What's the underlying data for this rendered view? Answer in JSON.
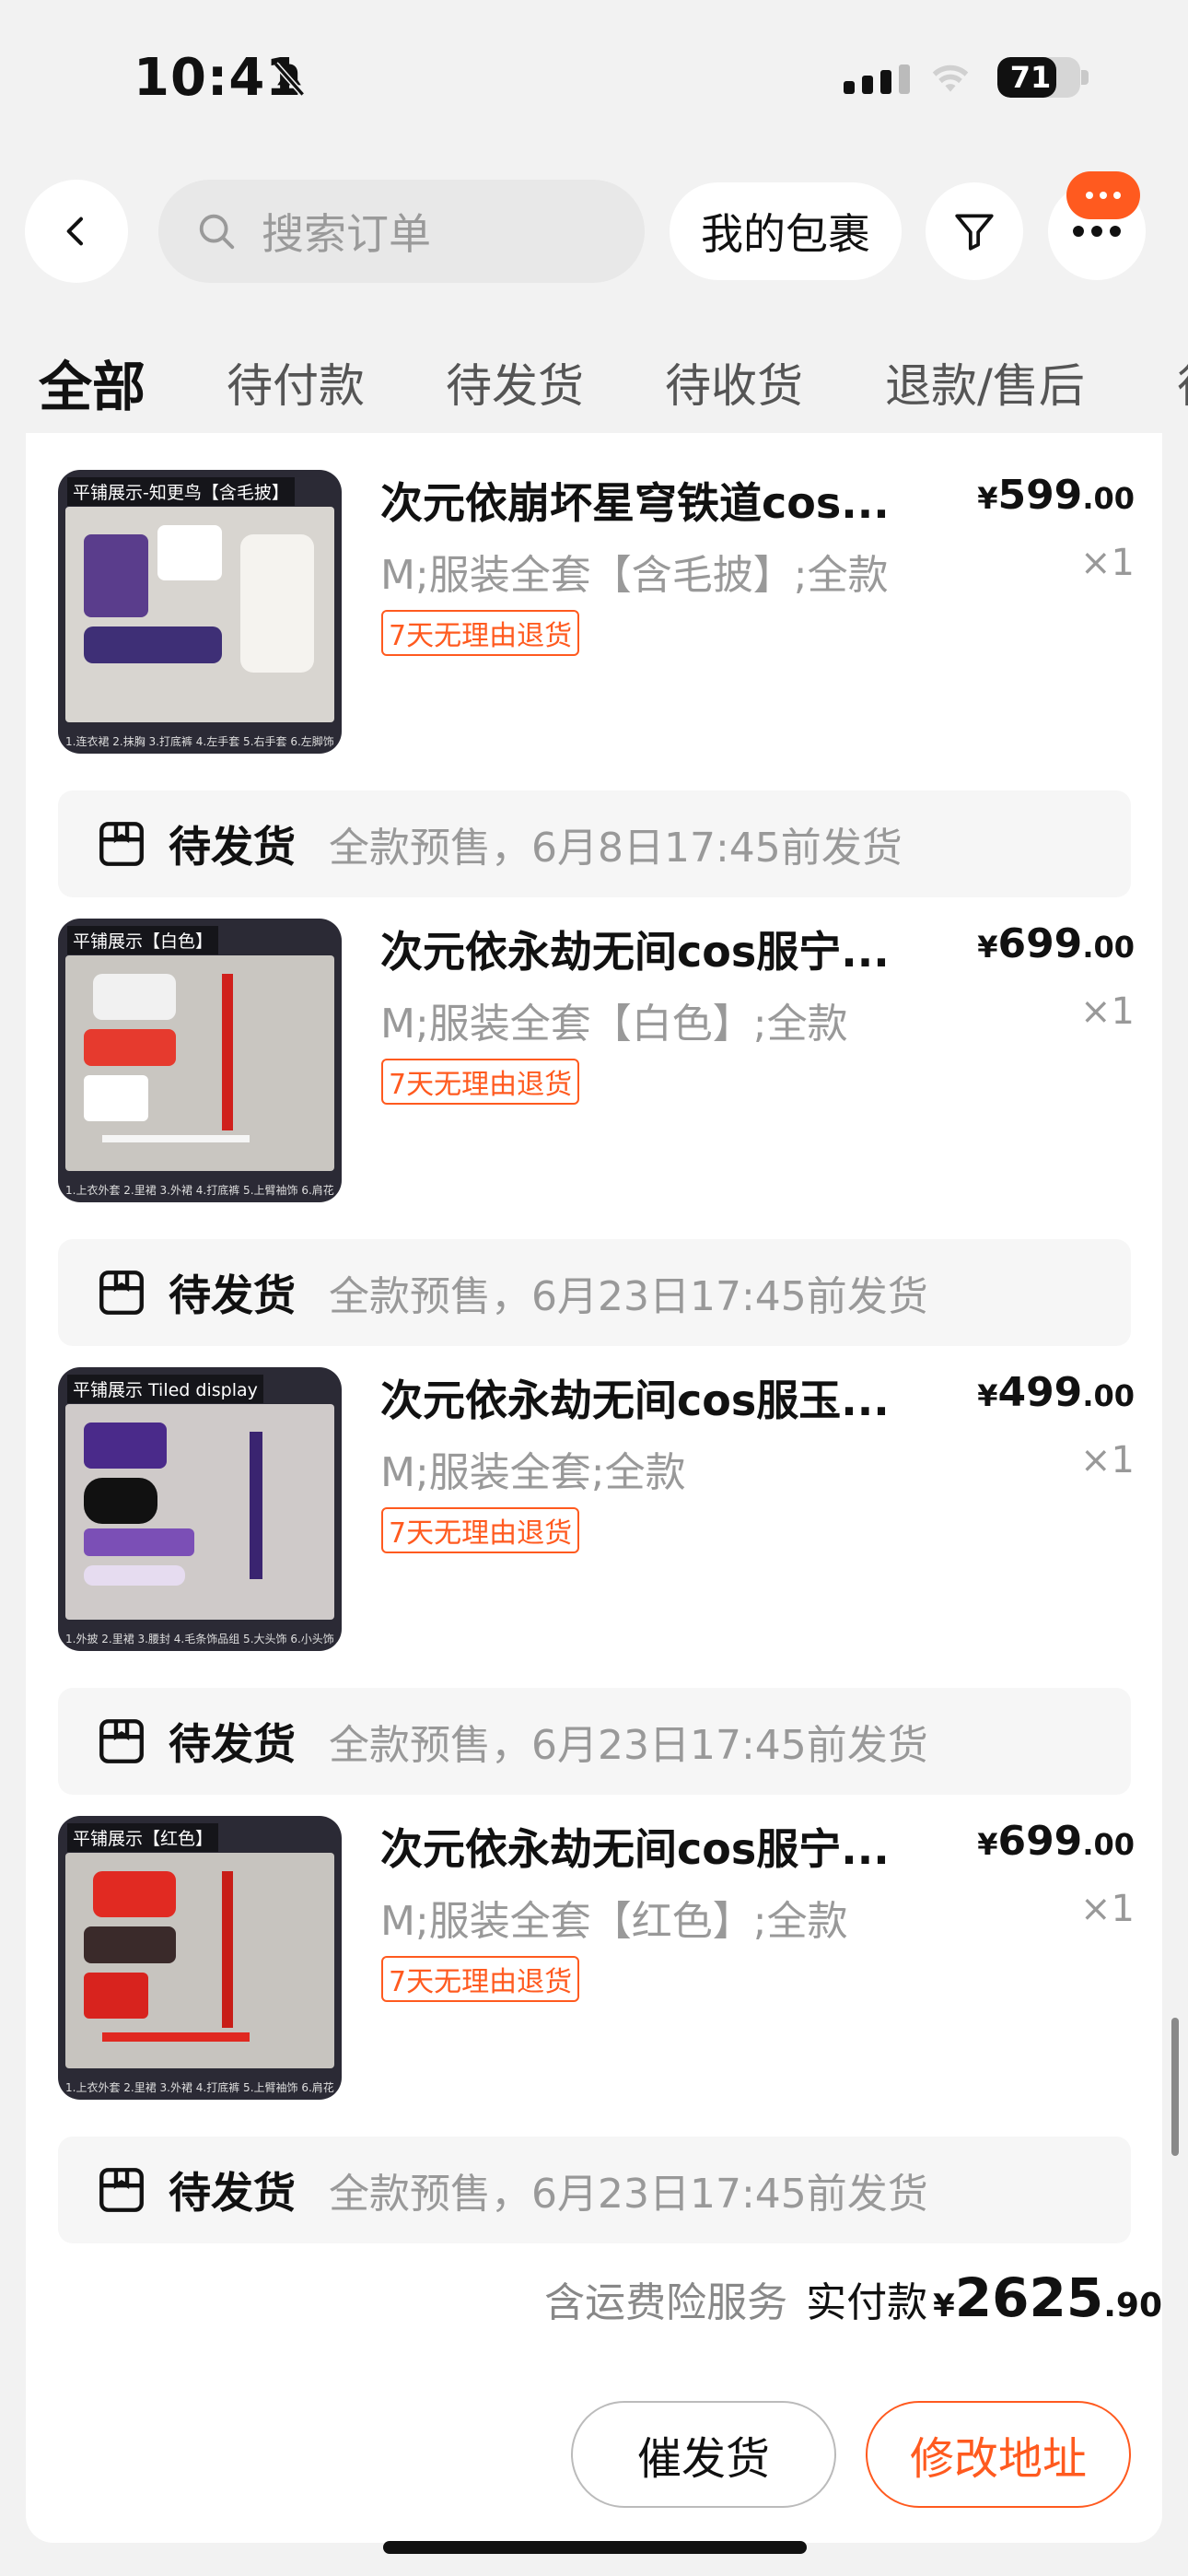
{
  "status_bar": {
    "time": "10:41",
    "battery": "71",
    "battery_level": 0.71
  },
  "header": {
    "search_placeholder": "搜索订单",
    "packages_label": "我的包裹"
  },
  "tabs": [
    "全部",
    "待付款",
    "待发货",
    "待收货",
    "退款/售后",
    "待"
  ],
  "items": [
    {
      "thumb_label": "平铺展示-知更鸟【含毛披】",
      "title": "次元依崩坏星穹铁道cos...",
      "price_yen": "¥",
      "price_int": "599",
      "price_dec": ".00",
      "spec": "M;服装全套【含毛披】;全款",
      "qty": "×1",
      "tag": "7天无理由退货",
      "legend": "1.连衣裙 2.抹胸 3.打底裤 4.左手套 5.右手套 6.左脚饰"
    },
    {
      "thumb_label": "平铺展示【白色】",
      "title": "次元依永劫无间cos服宁...",
      "price_yen": "¥",
      "price_int": "699",
      "price_dec": ".00",
      "spec": "M;服装全套【白色】;全款",
      "qty": "×1",
      "tag": "7天无理由退货",
      "legend": "1.上衣外套 2.里裙 3.外裙 4.打底裤 5.上臂袖饰 6.肩花"
    },
    {
      "thumb_label": "平铺展示 Tiled display",
      "title": "次元依永劫无间cos服玉...",
      "price_yen": "¥",
      "price_int": "499",
      "price_dec": ".00",
      "spec": "M;服装全套;全款",
      "qty": "×1",
      "tag": "7天无理由退货",
      "legend": "1.外披 2.里裙 3.腰封 4.毛条饰品组 5.大头饰 6.小头饰"
    },
    {
      "thumb_label": "平铺展示【红色】",
      "title": "次元依永劫无间cos服宁...",
      "price_yen": "¥",
      "price_int": "699",
      "price_dec": ".00",
      "spec": "M;服装全套【红色】;全款",
      "qty": "×1",
      "tag": "7天无理由退货",
      "legend": "1.上衣外套 2.里裙 3.外裙 4.打底裤 5.上臂袖饰 6.肩花"
    }
  ],
  "shipments": [
    {
      "status": "待发货",
      "note": "全款预售，6月8日17:45前发货"
    },
    {
      "status": "待发货",
      "note": "全款预售，6月23日17:45前发货"
    },
    {
      "status": "待发货",
      "note": "全款预售，6月23日17:45前发货"
    },
    {
      "status": "待发货",
      "note": "全款预售，6月23日17:45前发货"
    }
  ],
  "summary": {
    "insurance": "含运费险服务",
    "paid_label": "实付款",
    "yen": "¥",
    "total_int": "2625",
    "total_dec": ".90"
  },
  "buttons": {
    "urge": "催发货",
    "change_address": "修改地址"
  },
  "colors": {
    "accent": "#ff5a1f",
    "background": "#f2f2f2"
  },
  "icons": [
    "back-icon",
    "search-icon",
    "filter-icon",
    "more-icon",
    "package-icon",
    "bell-slash-icon",
    "wifi-icon"
  ]
}
